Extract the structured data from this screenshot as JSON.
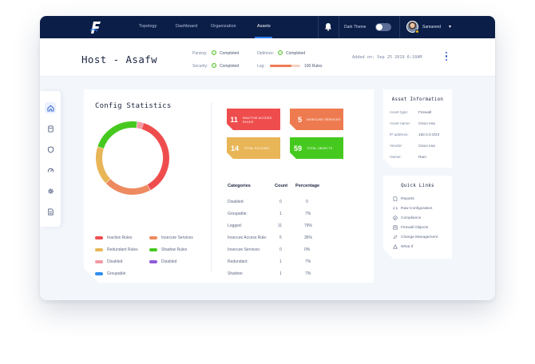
{
  "nav": {
    "links": [
      "Topology",
      "Dashboard",
      "Organization",
      "Assets"
    ],
    "active": "Assets",
    "dark_theme_label": "Dark Theme",
    "dark_theme_on": false,
    "user_name": "Samarend",
    "colors": {
      "bar": "#0b1e47",
      "accent": "#2f7cf6"
    }
  },
  "header": {
    "title": "Host - Asafw",
    "parsing_label": "Parsing:",
    "parsing_value": "Completed",
    "security_label": "Security:",
    "security_value": "Completed",
    "optimize_label": "Optimize:",
    "optimize_value": "Completed",
    "log_label": "Log:",
    "log_value": "100 Rules",
    "log_progress": 0.72,
    "added_on": "Added on: Sep 25 2019 6:10AM"
  },
  "rail": {
    "items": [
      "home-icon",
      "server-icon",
      "shield-icon",
      "gauge-icon",
      "gear-icon",
      "report-icon"
    ],
    "active_index": 0
  },
  "config": {
    "title": "Config Statistics",
    "stats": [
      {
        "value": "11",
        "label": "Inactive Access Rules",
        "color": "#ef4d4d"
      },
      {
        "value": "5",
        "label": "Insecure Services",
        "color": "#ee7b50"
      },
      {
        "value": "14",
        "label": "Total Policies",
        "color": "#e8b557"
      },
      {
        "value": "59",
        "label": "Total Objects",
        "color": "#46c91f"
      }
    ],
    "legend": [
      {
        "label": "Inactive Rules",
        "color": "#ef4d4d"
      },
      {
        "label": "Insecure Services",
        "color": "#ee8a5f"
      },
      {
        "label": "Redundant Rules",
        "color": "#e8b557"
      },
      {
        "label": "Shadow Rules",
        "color": "#46c91f"
      },
      {
        "label": "Disabled",
        "color": "#f39aa5"
      },
      {
        "label": "Disabled",
        "color": "#8e5bdc"
      },
      {
        "label": "Groupable",
        "color": "#2d8ef0"
      }
    ],
    "table_headers": [
      "Categories",
      "Count",
      "Percentage"
    ],
    "table_rows": [
      [
        "Disabled:",
        "0",
        "0"
      ],
      [
        "Groupable:",
        "1",
        "7%"
      ],
      [
        "Logged:",
        "11",
        "79%"
      ],
      [
        "Insecure Access Rule:",
        "5",
        "36%"
      ],
      [
        "Insecure Services:",
        "0",
        "0%"
      ],
      [
        "Redundant:",
        "1",
        "7%"
      ],
      [
        "Shadow:",
        "1",
        "7%"
      ],
      [
        "Unused Objects:",
        "25",
        "42%"
      ]
    ]
  },
  "chart_data": {
    "type": "pie",
    "categories": [
      "Inactive Rules",
      "Insecure Services",
      "Redundant Rules",
      "Shadow Rules",
      "Disabled"
    ],
    "values": [
      37,
      21,
      17,
      22,
      3
    ],
    "colors": [
      "#ef4d4d",
      "#ee8a5f",
      "#e8b557",
      "#46c91f",
      "#f39aa5"
    ]
  },
  "asset_info": {
    "title": "Asset Information",
    "rows": [
      [
        "Asset type:",
        "Firewall"
      ],
      [
        "Asset name:",
        "Cisco Asa"
      ],
      [
        "IP address:",
        "192.0.0.0/23"
      ],
      [
        "Vendor:",
        "Cisco Asa"
      ],
      [
        "Owner:",
        "Ram"
      ]
    ]
  },
  "quick_links": {
    "title": "Quick Links",
    "items": [
      {
        "label": "Reports",
        "icon": "document-icon"
      },
      {
        "label": "Raw Configuration",
        "icon": "code-icon"
      },
      {
        "label": "Compliance",
        "icon": "compliance-icon"
      },
      {
        "label": "Firewall Objects",
        "icon": "firewall-icon"
      },
      {
        "label": "Change Management",
        "icon": "change-icon"
      },
      {
        "label": "What If",
        "icon": "whatif-icon"
      }
    ]
  }
}
